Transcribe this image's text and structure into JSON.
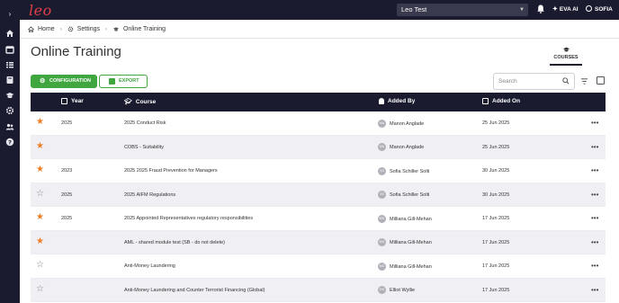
{
  "app": {
    "logo_text": "leo",
    "org_selector": "Leo Test",
    "eva_label": "EVA AI",
    "user_label": "SOFIA"
  },
  "breadcrumb": [
    "Home",
    "Settings",
    "Online Training"
  ],
  "page": {
    "title": "Online Training",
    "courses_tab": "COURSES"
  },
  "toolbar": {
    "config_label": "CONFIGURATION",
    "export_label": "EXPORT",
    "search_placeholder": "Search"
  },
  "table": {
    "headers": {
      "year": "Year",
      "course": "Course",
      "added_by": "Added By",
      "added_on": "Added On"
    },
    "rows": [
      {
        "starred": true,
        "year": "2025",
        "course": "2025 Conduct Risk",
        "initials": "MA",
        "added_by": "Manon Anglade",
        "added_on": "25 Jun 2025"
      },
      {
        "starred": true,
        "year": "",
        "course": "COBS - Suitability",
        "initials": "MA",
        "added_by": "Manon Anglade",
        "added_on": "25 Jun 2025"
      },
      {
        "starred": true,
        "year": "2023",
        "course": "2025 2025 Fraud Prevention for Managers",
        "initials": "SS",
        "added_by": "Sofia Schiller Solti",
        "added_on": "30 Jun 2025"
      },
      {
        "starred": false,
        "year": "2025",
        "course": "2025 AIFM Regulations",
        "initials": "SS",
        "added_by": "Sofia Schiller Solti",
        "added_on": "30 Jun 2025"
      },
      {
        "starred": true,
        "year": "2025",
        "course": "2025 Appointed Representatives regulatory responsibilities",
        "initials": "MG",
        "added_by": "Milliana Gill-Mehan",
        "added_on": "17 Jun 2025"
      },
      {
        "starred": true,
        "year": "",
        "course": "AML - shared module test (SB - do not delete)",
        "initials": "MG",
        "added_by": "Milliana Gill-Mehan",
        "added_on": "17 Jun 2025"
      },
      {
        "starred": false,
        "year": "",
        "course": "Anti-Money Laundering",
        "initials": "MG",
        "added_by": "Milliana Gill-Mehan",
        "added_on": "17 Jun 2025"
      },
      {
        "starred": false,
        "year": "",
        "course": "Anti-Money Laundering and Counter Terrorist Financing (Global)",
        "initials": "EW",
        "added_by": "Elliot Wyllie",
        "added_on": "17 Jun 2025"
      }
    ]
  },
  "colors": {
    "nav_bg": "#1b1b2f",
    "brand_red": "#e0404a",
    "primary_green": "#3fa640",
    "star_orange": "#ef7d22"
  },
  "icons": {
    "sidebar": [
      "chevron-right-icon",
      "home-icon",
      "calendar-icon",
      "list-icon",
      "book-icon",
      "graduation-cap-icon",
      "gear-icon",
      "users-icon",
      "help-icon"
    ]
  }
}
